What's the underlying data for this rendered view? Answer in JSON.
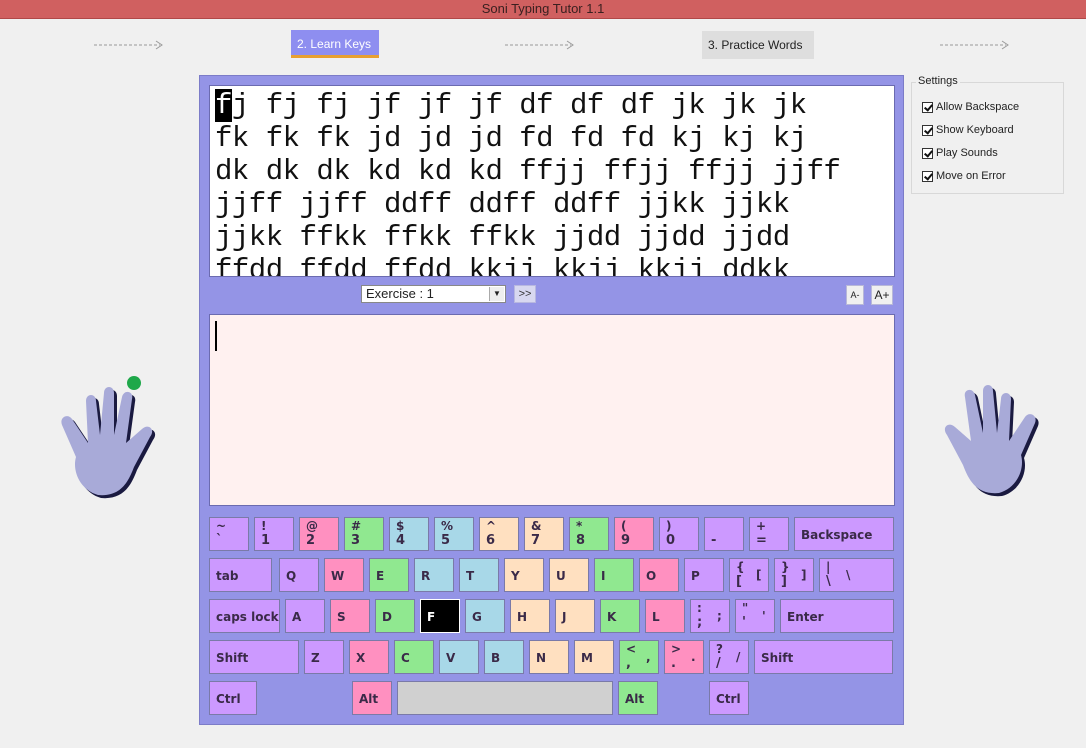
{
  "window": {
    "title": "Soni Typing Tutor 1.1"
  },
  "steps": {
    "active_label": "2. Learn Keys",
    "next_label": "3. Practice Words"
  },
  "lesson": {
    "current_char": "f",
    "lines": [
      "j fj fj jf jf jf df df df jk jk jk",
      "fk fk fk jd jd jd fd fd fd kj kj kj",
      "dk dk dk kd kd kd ffjj ffjj ffjj jjff",
      "jjff jjff ddff ddff ddff jjkk jjkk",
      "jjkk ffkk ffkk ffkk jjdd jjdd jjdd",
      "ffdd ffdd ffdd kkjj kkjj kkjj ddkk"
    ]
  },
  "toolbar": {
    "exercise_value": "Exercise : 1",
    "next_label": ">>",
    "font_decrease": "A-",
    "font_increase": "A+"
  },
  "typing_area": {
    "value": ""
  },
  "settings": {
    "title": "Settings",
    "options": [
      {
        "label": "Allow Backspace",
        "checked": true
      },
      {
        "label": "Show Keyboard",
        "checked": true
      },
      {
        "label": "Play Sounds",
        "checked": true
      },
      {
        "label": "Move on Error",
        "checked": true
      }
    ]
  },
  "colors": {
    "purple": "#cc99ff",
    "pink": "#ff90c0",
    "green": "#90e890",
    "blue": "#a8d8e8",
    "peach": "#ffe0c0",
    "highlight": "#000000",
    "panel": "#9494e6",
    "finger_indicator": "#1fa84a"
  },
  "keyboard": {
    "highlighted_key": "F",
    "rows": [
      [
        {
          "up": "~",
          "dn": "`",
          "c": "purple"
        },
        {
          "up": "!",
          "dn": "1",
          "c": "purple"
        },
        {
          "up": "@",
          "dn": "2",
          "c": "pink"
        },
        {
          "up": "#",
          "dn": "3",
          "c": "green"
        },
        {
          "up": "$",
          "dn": "4",
          "c": "blue"
        },
        {
          "up": "%",
          "dn": "5",
          "c": "blue"
        },
        {
          "up": "^",
          "dn": "6",
          "c": "peach"
        },
        {
          "up": "&",
          "dn": "7",
          "c": "peach"
        },
        {
          "up": "*",
          "dn": "8",
          "c": "green"
        },
        {
          "up": "(",
          "dn": "9",
          "c": "pink"
        },
        {
          "up": ")",
          "dn": "0",
          "c": "purple"
        },
        {
          "up": "",
          "dn": "-",
          "c": "purple"
        },
        {
          "up": "+",
          "dn": "=",
          "c": "purple"
        },
        {
          "label": "Backspace",
          "c": "purple"
        }
      ],
      [
        {
          "label": "tab",
          "c": "purple"
        },
        {
          "label": "Q",
          "c": "purple"
        },
        {
          "label": "W",
          "c": "pink"
        },
        {
          "label": "E",
          "c": "green"
        },
        {
          "label": "R",
          "c": "blue"
        },
        {
          "label": "T",
          "c": "blue"
        },
        {
          "label": "Y",
          "c": "peach"
        },
        {
          "label": "U",
          "c": "peach"
        },
        {
          "label": "I",
          "c": "green"
        },
        {
          "label": "O",
          "c": "pink"
        },
        {
          "label": "P",
          "c": "purple"
        },
        {
          "up": "{",
          "dn": "[",
          "right": "[",
          "c": "purple"
        },
        {
          "up": "}",
          "dn": "]",
          "right": "]",
          "c": "purple"
        },
        {
          "up": "|",
          "dn": "\\",
          "right": "\\",
          "c": "purple"
        }
      ],
      [
        {
          "label": "caps lock",
          "c": "purple"
        },
        {
          "label": "A",
          "c": "purple"
        },
        {
          "label": "S",
          "c": "pink"
        },
        {
          "label": "D",
          "c": "green"
        },
        {
          "label": "F",
          "c": "black"
        },
        {
          "label": "G",
          "c": "blue"
        },
        {
          "label": "H",
          "c": "peach"
        },
        {
          "label": "J",
          "c": "peach"
        },
        {
          "label": "K",
          "c": "green"
        },
        {
          "label": "L",
          "c": "pink"
        },
        {
          "up": ":",
          "dn": ";",
          "right": ";",
          "c": "purple"
        },
        {
          "up": "\"",
          "dn": "'",
          "right": "'",
          "c": "purple"
        },
        {
          "label": "Enter",
          "c": "purple"
        }
      ],
      [
        {
          "label": "Shift",
          "c": "purple"
        },
        {
          "label": "Z",
          "c": "purple"
        },
        {
          "label": "X",
          "c": "pink"
        },
        {
          "label": "C",
          "c": "green"
        },
        {
          "label": "V",
          "c": "blue"
        },
        {
          "label": "B",
          "c": "blue"
        },
        {
          "label": "N",
          "c": "peach"
        },
        {
          "label": "M",
          "c": "peach"
        },
        {
          "up": "<",
          "dn": ",",
          "right": ",",
          "c": "green"
        },
        {
          "up": ">",
          "dn": ".",
          "right": ".",
          "c": "pink"
        },
        {
          "up": "?",
          "dn": "/",
          "right": "/",
          "c": "purple"
        },
        {
          "label": "Shift",
          "c": "purple"
        }
      ],
      [
        {
          "label": "Ctrl",
          "c": "purple"
        },
        {
          "label": "Alt",
          "c": "pink"
        },
        {
          "label": "",
          "c": "grey"
        },
        {
          "label": "Alt",
          "c": "green"
        },
        {
          "label": "Ctrl",
          "c": "purple"
        }
      ]
    ]
  }
}
